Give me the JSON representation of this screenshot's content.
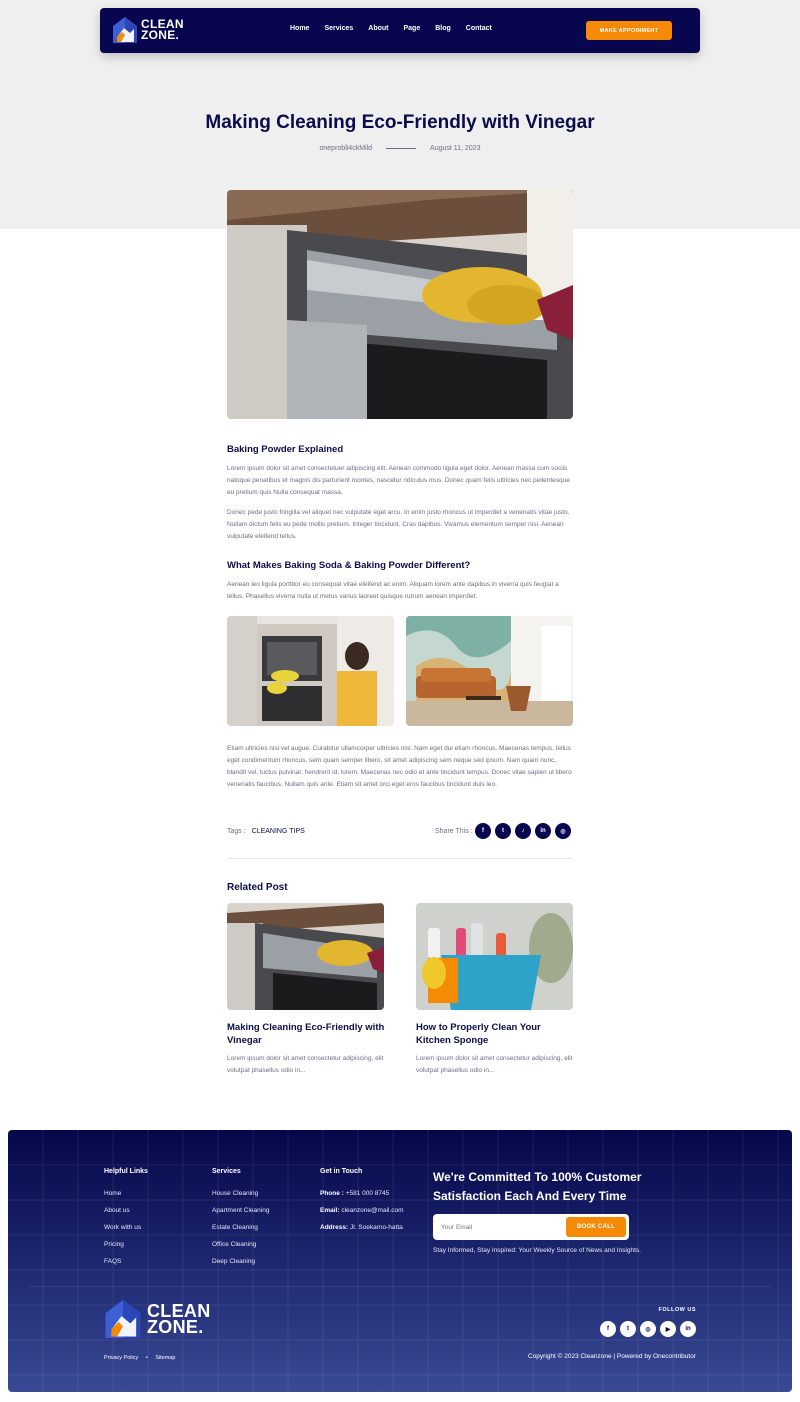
{
  "header": {
    "logo_line1": "CLEAN",
    "logo_line2": "ZONE.",
    "nav": [
      "Home",
      "Services",
      "About",
      "Page",
      "Blog",
      "Contact"
    ],
    "cta_label": "MAKE APPOINMENT"
  },
  "post": {
    "title": "Making Cleaning Eco-Friendly with Vinegar",
    "author": "oneprobli4ckMild",
    "date": "August 11, 2023",
    "section1_title": "Baking Powder Explained",
    "section1_p1": "Lorem ipsum dolor sit amet consectetuer adipiscing elit. Aenean commodo ligula eget dolor. Aenean massa cum sociis natoque penatibus et magnis dis parturient montes, nascetur ridiculus mus. Donec quam felis ultricies nec pellentesque eu pretium quis Nulla consequat massa.",
    "section1_p2": "Donec pede justo fringilla vel aliquet nec vulputate eget arcu. In enim justo rhoncus ut imperdiet a venenatis vitae justo. Nullam dictum felis eu pede mollis pretium. Integer tincidunt. Cras dapibus. Vivamus elementum semper nisi. Aenean vulputate eleifend tellus.",
    "section2_title": "What Makes Baking Soda & Baking Powder Different?",
    "section2_p1": "Aenean leo ligula porttitor eu consequat vitae eleifend ac enim. Aliquam lorem ante dapibus in viverra quis feugiat a tellus. Phasellus viverra nulla ut metus varius laoreet quisque rutrum aenean imperdiet.",
    "section2_p2": "Etiam ultricies nisi vel augue. Curabitur ullamcorper ultricies nisl. Nam eget dui etiam rhoncus. Maecenas tempus, tellus eget condimentum rhoncus, sem quam semper libero, sit amet adipiscing sem neque sed ipsum. Nam quam nunc, blandit vel, luctus pulvinar, hendrerit id, lorem. Maecenas nec odio et ante tincidunt tempus. Donec vitae sapien ut libero venenatis faucibus. Nullam quis ante. Etiam sit amet orci eget eros faucibus tincidunt duis leo.",
    "tags_label": "Tags :",
    "tag": "CLEANING TIPS",
    "share_label": "Share This :",
    "share_icons": [
      "f",
      "t",
      "♪",
      "in",
      "◎"
    ]
  },
  "related": {
    "title": "Related Post",
    "items": [
      {
        "title": "Making Cleaning Eco-Friendly with Vinegar",
        "excerpt": "Lorem ipsum dolor sit amet consectetur adipiscing, elit volutpat phasellus odio in..."
      },
      {
        "title": "How to Properly Clean Your Kitchen Sponge",
        "excerpt": "Lorem ipsum dolor sit amet consectetur adipiscing, elit volutpat phasellus odio in..."
      }
    ]
  },
  "footer": {
    "helpful_title": "Helpful Links",
    "helpful": [
      "Home",
      "About us",
      "Work with us",
      "Pricing",
      "FAQS"
    ],
    "services_title": "Services",
    "services": [
      "House Cleaning",
      "Apartment Cleaning",
      "Estate Cleaning",
      "Office Cleaning",
      "Deep Cleaning"
    ],
    "contact_title": "Get in Touch",
    "phone_label": "Phone :",
    "phone": "+581 000 8745",
    "email_label": "Email:",
    "email": "cleanzone@mail.com",
    "address_label": "Address:",
    "address": "Jl. Soekarno-hatta",
    "commit": "We're Committed To 100% Customer Satisfaction Each And Every Time",
    "email_placeholder": "Your Email",
    "book_label": "BOOK CALL",
    "stay": "Stay Informed, Stay Inspired: Your Weekly Source of News and Insights.",
    "follow": "FOLLOW US",
    "social": [
      "f",
      "t",
      "◎",
      "▶",
      "in"
    ],
    "privacy": "Privacy Policy",
    "sitemap": "Sitemap",
    "copyright": "Copyright © 2023 Cleanzone | Powered by Onecontributor"
  },
  "colors": {
    "navy": "#07064f",
    "orange": "#f58a07",
    "muted": "#6b6f86"
  }
}
